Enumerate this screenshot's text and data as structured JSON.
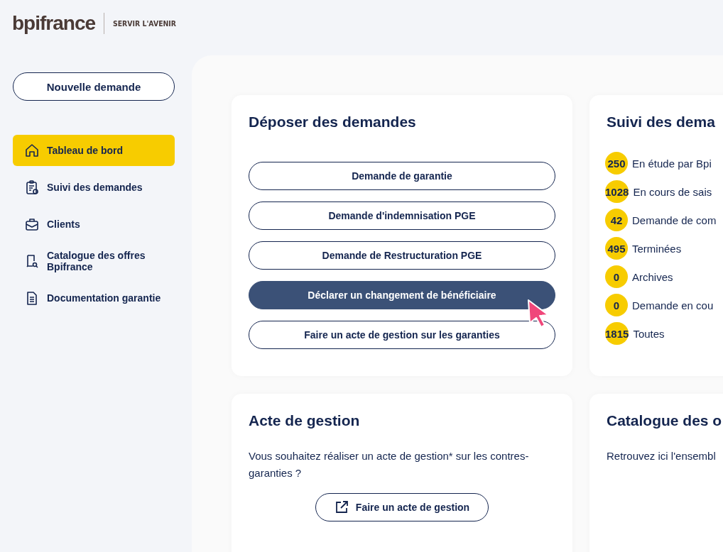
{
  "logo": {
    "brand": "bpifrance",
    "tagline": "SERVIR L'AVENIR"
  },
  "sidebar": {
    "new_button": "Nouvelle demande",
    "items": [
      {
        "label": "Tableau de bord",
        "selected": true
      },
      {
        "label": "Suivi des demandes",
        "selected": false
      },
      {
        "label": "Clients",
        "selected": false
      },
      {
        "label": "Catalogue des offres Bpifrance",
        "selected": false
      },
      {
        "label": "Documentation garantie",
        "selected": false
      }
    ]
  },
  "deposit_card": {
    "title": "Déposer des demandes",
    "buttons": [
      {
        "label": "Demande de garantie",
        "selected": false
      },
      {
        "label": "Demande d'indemnisation PGE",
        "selected": false
      },
      {
        "label": "Demande de Restructuration PGE",
        "selected": false
      },
      {
        "label": "Déclarer un changement de bénéficiaire",
        "selected": true
      },
      {
        "label": "Faire un acte de gestion sur les garanties",
        "selected": false
      }
    ]
  },
  "tracking_card": {
    "title": "Suivi des dema",
    "stats": [
      {
        "count": "250",
        "label": "En étude par Bpi"
      },
      {
        "count": "1028",
        "label": "En cours de sais"
      },
      {
        "count": "42",
        "label": "Demande de com"
      },
      {
        "count": "495",
        "label": "Terminées"
      },
      {
        "count": "0",
        "label": "Archives"
      },
      {
        "count": "0",
        "label": "Demande en cou"
      },
      {
        "count": "1815",
        "label": "Toutes"
      }
    ]
  },
  "acte_card": {
    "title": "Acte de gestion",
    "text": "Vous souhaitez réaliser un acte de gestion* sur les contres-garanties ?",
    "button": "Faire un acte de gestion"
  },
  "catalog_card": {
    "title": "Catalogue des o",
    "text": "Retrouvez ici l'ensembl"
  }
}
